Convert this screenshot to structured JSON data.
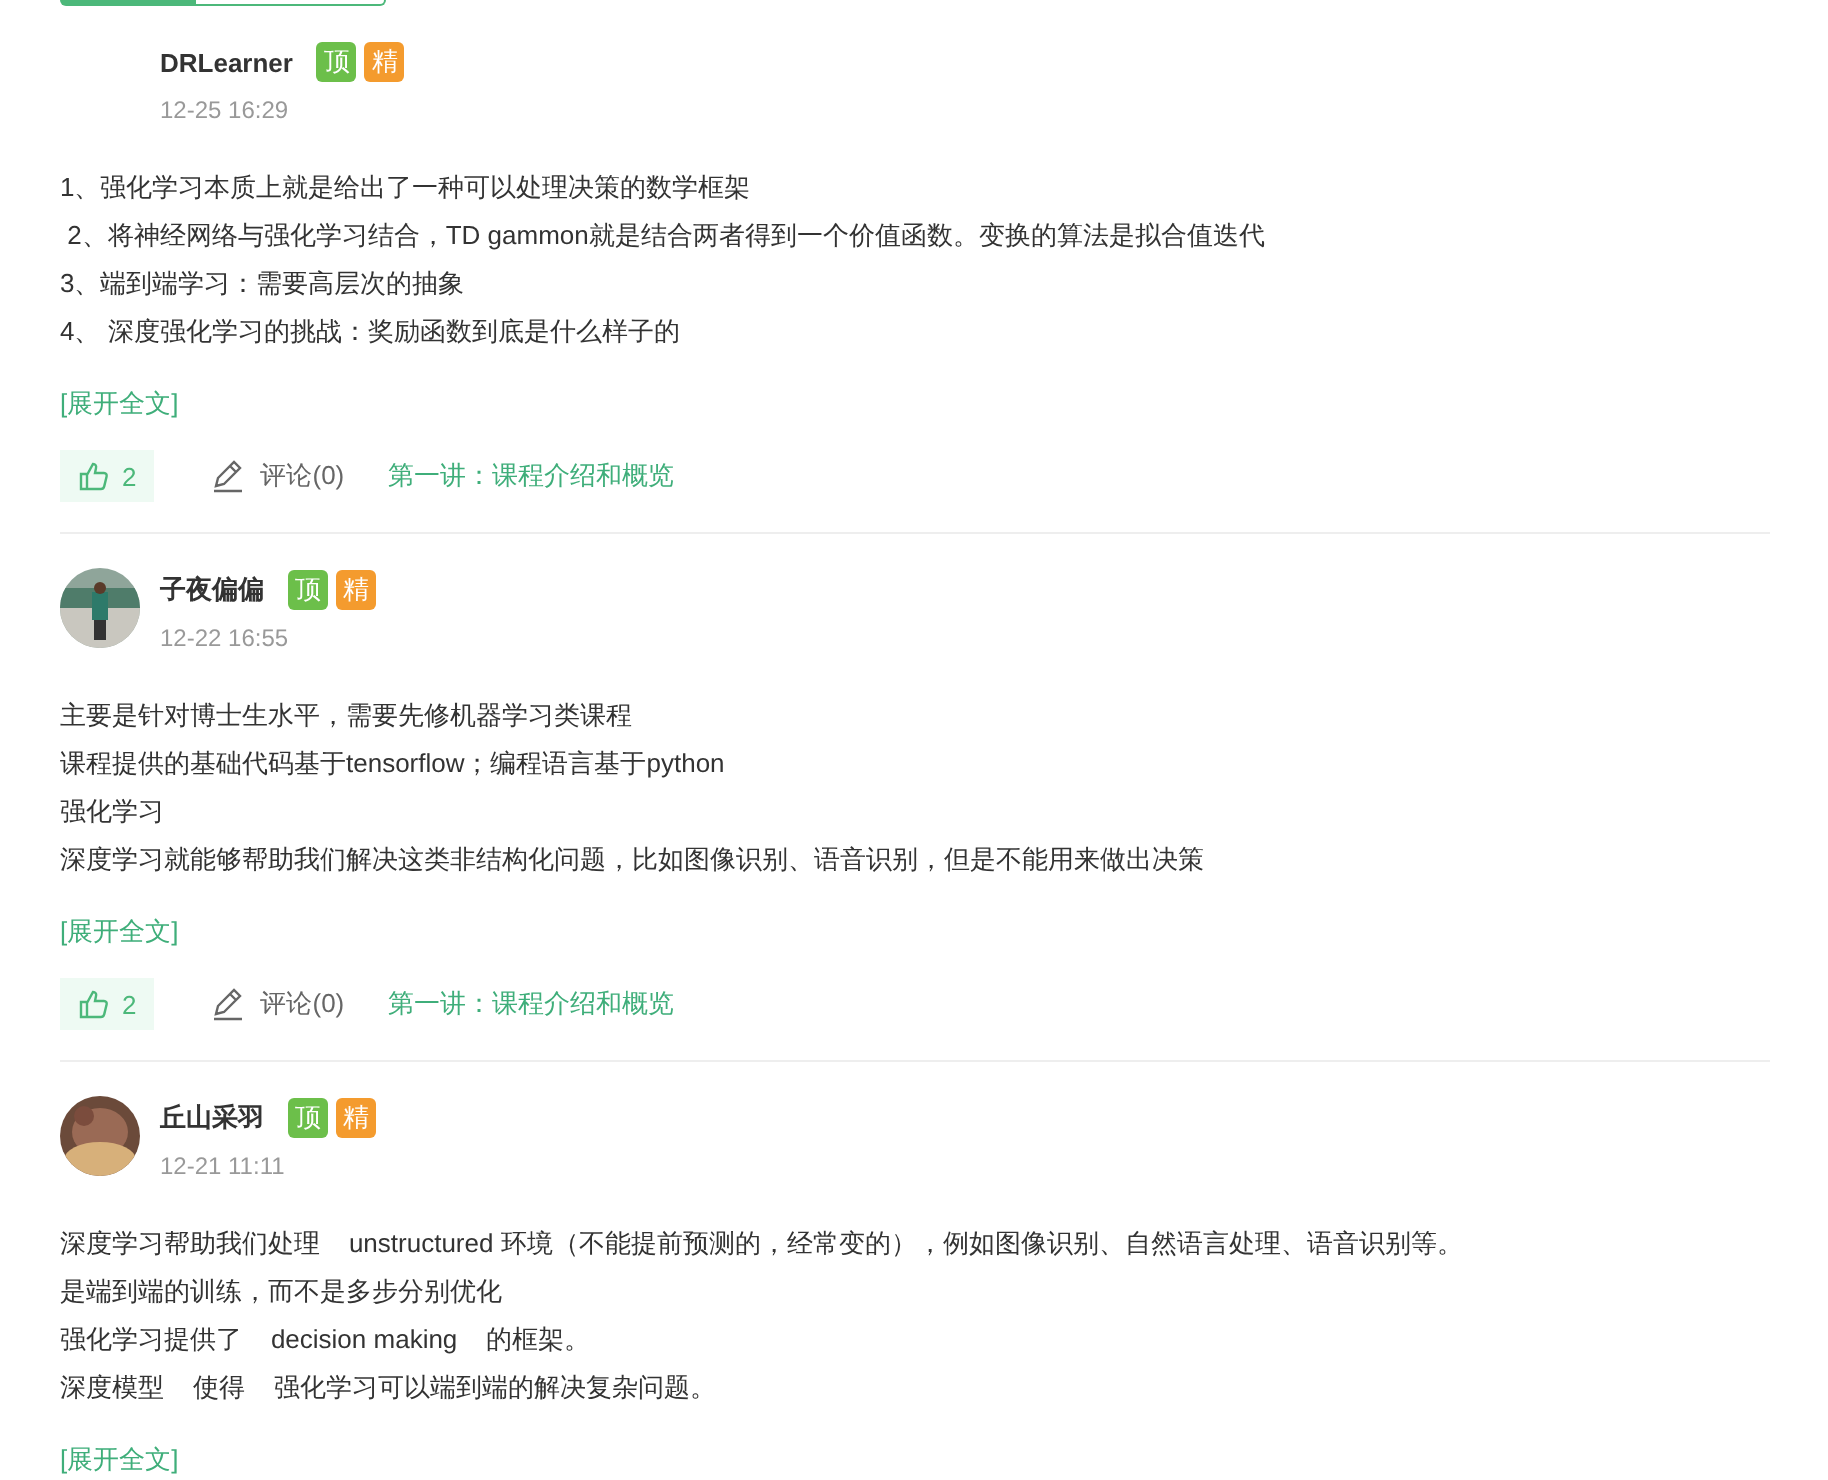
{
  "top_tabs": [
    {
      "selected": true
    },
    {
      "selected": false
    }
  ],
  "comments": [
    {
      "author": "DRLearner",
      "badges": [
        {
          "label": "顶",
          "kind": "top"
        },
        {
          "label": "精",
          "kind": "featured"
        }
      ],
      "time": "12-25 16:29",
      "lines": [
        "1、强化学习本质上就是给出了一种可以处理决策的数学框架",
        " 2、将神经网络与强化学习结合，TD gammon就是结合两者得到一个价值函数。变换的算法是拟合值迭代",
        "3、端到端学习：需要高层次的抽象",
        "4、 深度强化学习的挑战：奖励函数到底是什么样子的"
      ],
      "expand": "[展开全文]",
      "likes": "2",
      "comment_link": "评论(0)",
      "lesson": "第一讲：课程介绍和概览"
    },
    {
      "author": "子夜偏偏",
      "avatar": {
        "kind": "picture"
      },
      "badges": [
        {
          "label": "顶",
          "kind": "top"
        },
        {
          "label": "精",
          "kind": "featured"
        }
      ],
      "time": "12-22 16:55",
      "lines": [
        "主要是针对博士生水平，需要先修机器学习类课程",
        "课程提供的基础代码基于tensorflow；编程语言基于python",
        "强化学习",
        "深度学习就能够帮助我们解决这类非结构化问题，比如图像识别、语音识别，但是不能用来做出决策"
      ],
      "expand": "[展开全文]",
      "likes": "2",
      "comment_link": "评论(0)",
      "lesson": "第一讲：课程介绍和概览"
    },
    {
      "author": "丘山采羽",
      "avatar": {
        "kind": "picture"
      },
      "badges": [
        {
          "label": "顶",
          "kind": "top"
        },
        {
          "label": "精",
          "kind": "featured"
        }
      ],
      "time": "12-21 11:11",
      "lines": [
        "深度学习帮助我们处理    unstructured 环境（不能提前预测的，经常变的），例如图像识别、自然语言处理、语音识别等。",
        "是端到端的训练，而不是多步分别优化",
        "强化学习提供了    decision making    的框架。",
        "深度模型    使得    强化学习可以端到端的解决复杂问题。"
      ],
      "expand": "[展开全文]"
    }
  ]
}
